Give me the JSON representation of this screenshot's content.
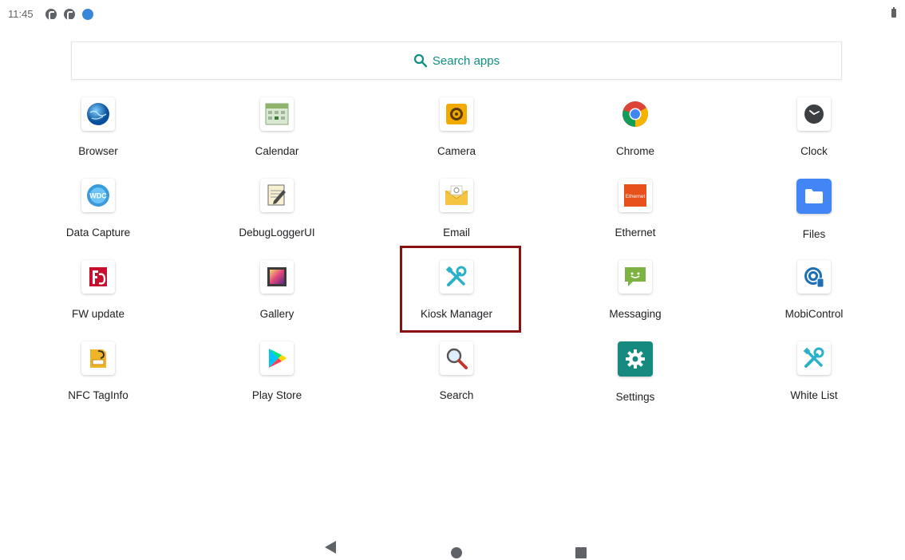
{
  "status_bar": {
    "time": "11:45",
    "notification_icons": [
      "notification-p-icon",
      "notification-p-icon",
      "notification-app-icon"
    ],
    "battery_icon": "battery-icon"
  },
  "search": {
    "label": "Search apps",
    "icon": "search-icon",
    "accent_color": "#0e8f83"
  },
  "apps": [
    [
      {
        "label": "Browser",
        "icon": "browser-globe-icon"
      },
      {
        "label": "Calendar",
        "icon": "calendar-icon"
      },
      {
        "label": "Camera",
        "icon": "camera-icon"
      },
      {
        "label": "Chrome",
        "icon": "chrome-icon"
      },
      {
        "label": "Clock",
        "icon": "clock-icon"
      }
    ],
    [
      {
        "label": "Data Capture",
        "icon": "data-capture-icon"
      },
      {
        "label": "DebugLoggerUI",
        "icon": "debug-logger-icon"
      },
      {
        "label": "Email",
        "icon": "email-icon"
      },
      {
        "label": "Ethernet",
        "icon": "ethernet-icon"
      },
      {
        "label": "Files",
        "icon": "files-folder-icon"
      }
    ],
    [
      {
        "label": "FW update",
        "icon": "fw-update-icon"
      },
      {
        "label": "Gallery",
        "icon": "gallery-icon"
      },
      {
        "label": "Kiosk Manager",
        "icon": "kiosk-tools-icon"
      },
      {
        "label": "Messaging",
        "icon": "messaging-icon"
      },
      {
        "label": "MobiControl",
        "icon": "mobicontrol-icon"
      }
    ],
    [
      {
        "label": "NFC TagInfo",
        "icon": "nfc-taginfo-icon"
      },
      {
        "label": "Play Store",
        "icon": "play-store-icon"
      },
      {
        "label": "Search",
        "icon": "magnifier-icon"
      },
      {
        "label": "Settings",
        "icon": "settings-gear-icon"
      },
      {
        "label": "White List",
        "icon": "white-list-tools-icon"
      }
    ]
  ],
  "ethernet_icon_text": "Ethernet",
  "data_capture_icon_text": "WDC",
  "highlight": {
    "app": "Kiosk Manager",
    "color": "#8b1111"
  },
  "nav_bar": {
    "back": "back-icon",
    "home": "home-icon",
    "recents": "recents-icon"
  }
}
